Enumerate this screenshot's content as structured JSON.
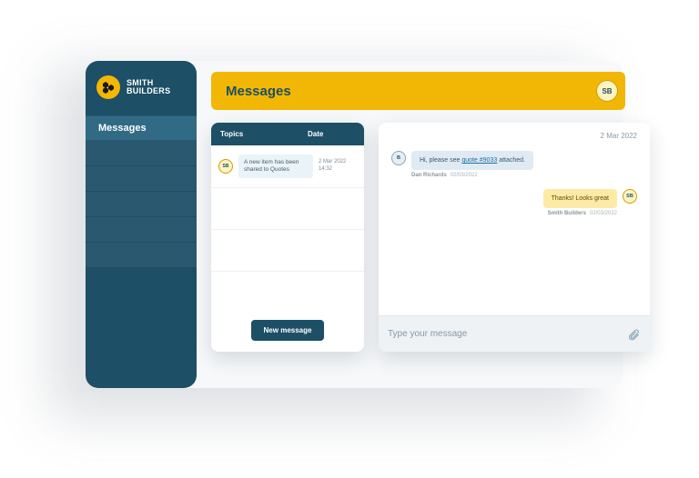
{
  "brand": {
    "line1": "SMITH",
    "line2": "BUILDERS"
  },
  "sidebar": {
    "items": [
      {
        "label": "Messages",
        "active": true
      },
      {
        "label": "",
        "active": false
      },
      {
        "label": "",
        "active": false
      },
      {
        "label": "",
        "active": false
      },
      {
        "label": "",
        "active": false
      },
      {
        "label": "",
        "active": false
      }
    ]
  },
  "header": {
    "title": "Messages",
    "avatar_initials": "SB"
  },
  "topics": {
    "columns": {
      "topics": "Topics",
      "date": "Date"
    },
    "rows": [
      {
        "avatar": "SB",
        "text": "A new item has been shared to Quotes",
        "date": "2 Mar 2022",
        "time": "14:32"
      }
    ],
    "new_message_label": "New message"
  },
  "chat": {
    "date": "2 Mar 2022",
    "messages": [
      {
        "direction": "incoming",
        "avatar": "B",
        "text_pre": "Hi, please see ",
        "link_text": "quote #9033",
        "text_post": " attached.",
        "author": "Dan Richards",
        "timestamp": "02/03/2022"
      },
      {
        "direction": "outgoing",
        "avatar": "SB",
        "text": "Thanks! Looks great",
        "author": "Smith Builders",
        "timestamp": "02/03/2022"
      }
    ],
    "compose_placeholder": "Type your message"
  }
}
